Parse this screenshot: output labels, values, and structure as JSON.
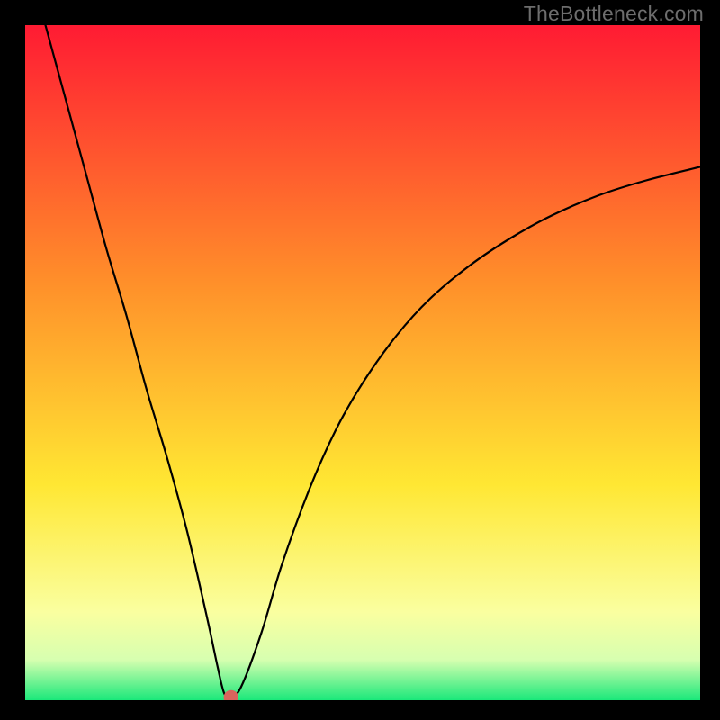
{
  "watermark": "TheBottleneck.com",
  "chart_data": {
    "type": "line",
    "title": "",
    "xlabel": "",
    "ylabel": "",
    "xlim": [
      0,
      100
    ],
    "ylim": [
      0,
      100
    ],
    "grid": false,
    "background_gradient": {
      "top": "#ff1b33",
      "mid_upper": "#ff8f2a",
      "mid": "#ffe733",
      "mid_lower": "#faffa0",
      "bottom": "#1ae87a"
    },
    "series": [
      {
        "name": "bottleneck-curve",
        "stroke": "#000000",
        "x": [
          3,
          6,
          9,
          12,
          15,
          18,
          21,
          24,
          27,
          28.5,
          29.5,
          30.5,
          32,
          35,
          38,
          42,
          46,
          50,
          55,
          60,
          66,
          72,
          78,
          85,
          92,
          100
        ],
        "y": [
          100,
          89,
          78,
          67,
          57,
          46,
          36,
          25,
          12,
          5,
          1,
          0.6,
          2,
          10,
          20,
          31,
          40,
          47,
          54,
          59.5,
          64.5,
          68.5,
          71.8,
          74.8,
          77,
          79
        ]
      }
    ],
    "marker": {
      "name": "sweet-spot",
      "x": 30.5,
      "y": 0.4,
      "color": "#d9655d",
      "r": 1.1
    }
  }
}
